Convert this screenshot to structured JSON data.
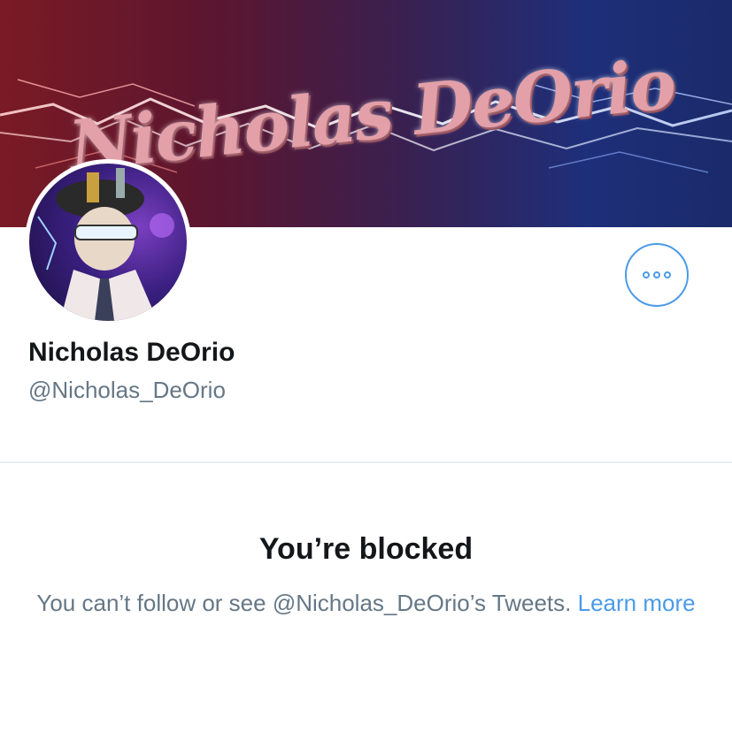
{
  "profile": {
    "banner_text": "Nicholas DeOrio",
    "display_name": "Nicholas DeOrio",
    "handle": "@Nicholas_DeOrio"
  },
  "actions": {
    "more_icon": "more-horizontal-icon"
  },
  "blocked": {
    "title": "You’re blocked",
    "message": "You can’t follow or see @Nicholas_DeOrio’s Tweets.",
    "link_label": "Learn more"
  },
  "colors": {
    "accent": "#4a9be8",
    "primary_text": "#14171a",
    "secondary_text": "#657786",
    "divider": "#e6ecf0"
  }
}
